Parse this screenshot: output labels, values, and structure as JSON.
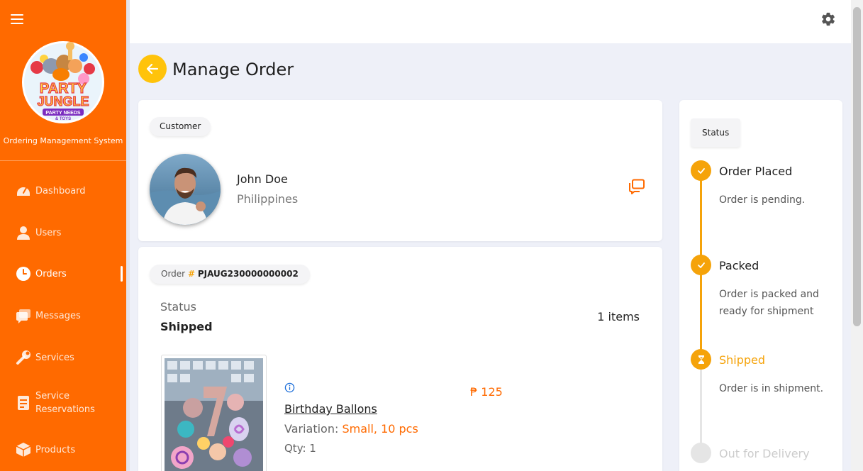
{
  "sidebar": {
    "system_name": "Ordering Management System",
    "items": [
      {
        "label": "Dashboard",
        "icon": "dashboard-icon"
      },
      {
        "label": "Users",
        "icon": "user-icon"
      },
      {
        "label": "Orders",
        "icon": "clock-icon",
        "active": true
      },
      {
        "label": "Messages",
        "icon": "messages-icon"
      },
      {
        "label": "Services",
        "icon": "wrench-icon"
      },
      {
        "label": "Service Reservations",
        "icon": "reservation-icon"
      },
      {
        "label": "Products",
        "icon": "box-icon"
      }
    ]
  },
  "logo": {
    "line1": "PARTY",
    "line2": "JUNGLE",
    "line3": "PARTY NEEDS",
    "line4": "& TOYS"
  },
  "page": {
    "title": "Manage Order"
  },
  "customer": {
    "pill": "Customer",
    "name": "John Doe",
    "country": "Philippines"
  },
  "order": {
    "pill_label": "Order",
    "pill_hash": "#",
    "pill_number": "PJAUG230000000002",
    "status_label": "Status",
    "status_value": "Shipped",
    "items_count": "1 items",
    "product": {
      "name": "Birthday Ballons",
      "variation_label": "Variation:",
      "variation_value": "Small, 10 pcs",
      "qty": "Qty: 1",
      "price": "₱ 125"
    }
  },
  "status_panel": {
    "pill": "Status",
    "steps": [
      {
        "title": "Order Placed",
        "desc": "Order is pending.",
        "state": "done"
      },
      {
        "title": "Packed",
        "desc": "Order is packed and ready for shipment",
        "state": "done"
      },
      {
        "title": "Shipped",
        "desc": "Order is in shipment.",
        "state": "current"
      },
      {
        "title": "Out for Delivery",
        "desc": "",
        "state": "pending"
      }
    ]
  },
  "colors": {
    "sidebar": "#ff6a00",
    "accent": "#ff6a00",
    "timeline": "#f5a30a",
    "back_button": "#ffc30b"
  }
}
